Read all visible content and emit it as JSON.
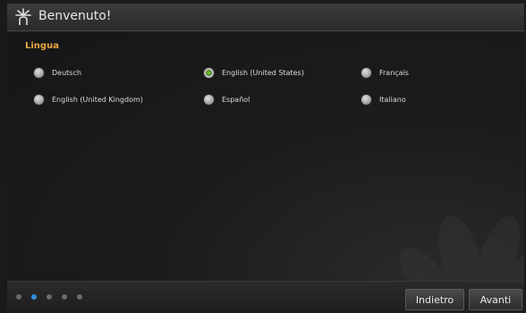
{
  "window": {
    "title": "Benvenuto!",
    "icon": "launcher-burst-icon"
  },
  "language": {
    "section_label": "Lingua",
    "selected": "English (United States)",
    "options": [
      {
        "label": "Deutsch",
        "selected": false
      },
      {
        "label": "English (United States)",
        "selected": true
      },
      {
        "label": "Français",
        "selected": false
      },
      {
        "label": "English (United Kingdom)",
        "selected": false
      },
      {
        "label": "Español",
        "selected": false
      },
      {
        "label": "Italiano",
        "selected": false
      }
    ]
  },
  "pager": {
    "total_pages": 5,
    "current_page": 2
  },
  "buttons": {
    "back_label": "Indietro",
    "next_label": "Avanti"
  },
  "colors": {
    "section_label": "#e8a645",
    "selected_radio": "#7ed321",
    "active_page_dot": "#2f8fe0"
  }
}
